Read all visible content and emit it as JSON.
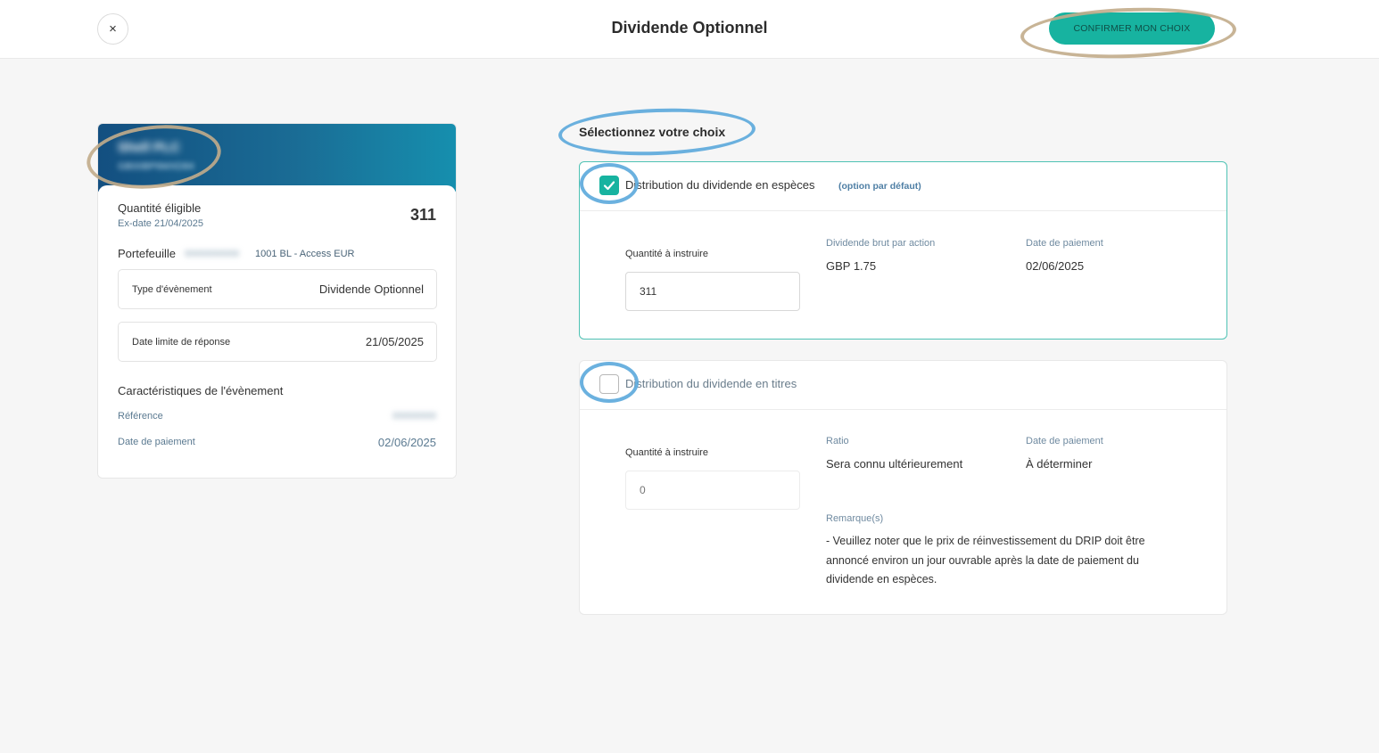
{
  "header": {
    "title": "Dividende Optionnel",
    "close_icon": "×",
    "confirm_label": "CONFIRMER MON CHOIX"
  },
  "left": {
    "company_name": "Shell PLC",
    "company_sub": "GB00BP6MXD84",
    "eligible_label": "Quantité éligible",
    "ex_date": "Ex-date 21/04/2025",
    "eligible_qty": "311",
    "portfolio_label": "Portefeuille",
    "portfolio_id": "0000000000",
    "portfolio_name": "1001 BL - Access EUR",
    "event_type_label": "Type d'évènement",
    "event_type_value": "Dividende Optionnel",
    "deadline_label": "Date limite de réponse",
    "deadline_value": "21/05/2025",
    "characteristics_title": "Caractéristiques de l'évènement",
    "reference_label": "Référence",
    "reference_value": "00000000",
    "payment_label": "Date de paiement",
    "payment_value": "02/06/2025"
  },
  "right": {
    "section_title": "Sélectionnez votre choix",
    "option1": {
      "label": "Distribution du dividende en espèces",
      "default_tag": "(option par défaut)",
      "checked": true,
      "qty_label": "Quantité à instruire",
      "qty_value": "311",
      "col1_label": "Dividende brut par action",
      "col1_value": "GBP 1.75",
      "col2_label": "Date de paiement",
      "col2_value": "02/06/2025"
    },
    "option2": {
      "label": "Distribution du dividende en titres",
      "checked": false,
      "qty_label": "Quantité à instruire",
      "qty_placeholder": "0",
      "col1_label": "Ratio",
      "col1_value": "Sera connu ultérieurement",
      "col2_label": "Date de paiement",
      "col2_value": "À déterminer",
      "remark_label": "Remarque(s)",
      "remark_text": "- Veuillez noter que le prix de réinvestissement du DRIP doit être annoncé environ un jour ouvrable après la date de paiement du dividende en espèces."
    }
  },
  "colors": {
    "accent": "#17b3a0",
    "highlight_tan": "#c2ac8b",
    "highlight_blue": "#5ba9dc"
  }
}
